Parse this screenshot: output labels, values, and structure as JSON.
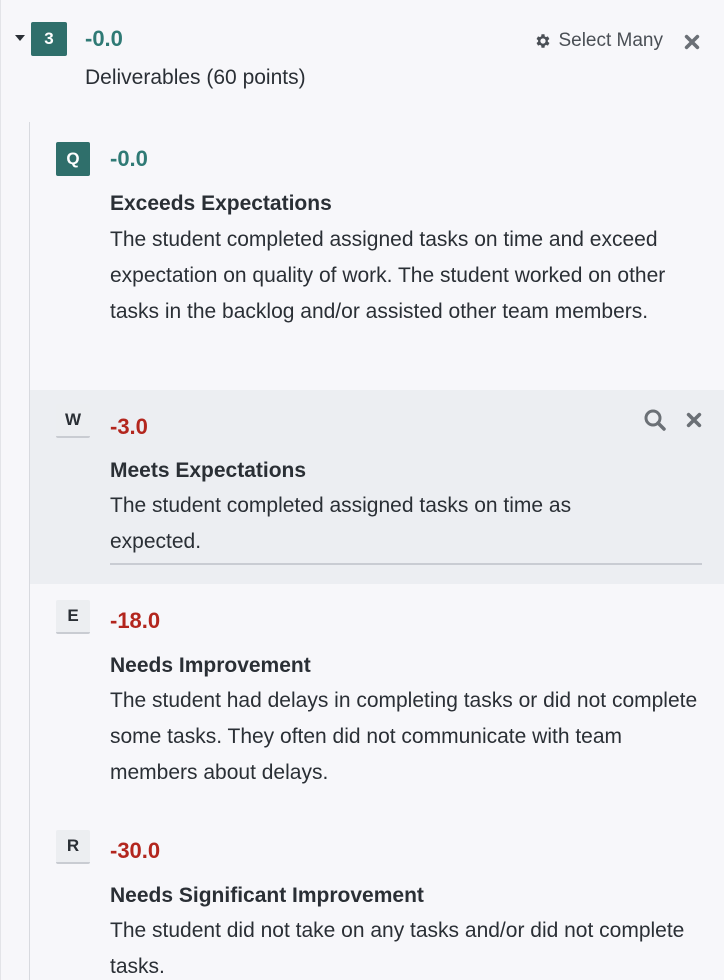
{
  "question": {
    "number": "3",
    "score": "-0.0",
    "title": "Deliverables (60 points)",
    "select_many_label": "Select Many"
  },
  "rubric_items": [
    {
      "key": "Q",
      "score": "-0.0",
      "name": "Exceeds Expectations",
      "description": "The student completed assigned tasks on time and exceed expectation on quality of work. The student worked on other tasks in the backlog and/or assisted other team members."
    },
    {
      "key": "W",
      "score": "-3.0",
      "name": "Meets Expectations",
      "description": "The student completed assigned tasks on time as expected."
    },
    {
      "key": "E",
      "score": "-18.0",
      "name": "Needs Improvement",
      "description": "The student had delays in completing tasks or did not complete some tasks. They often did not communicate with team members about delays."
    },
    {
      "key": "R",
      "score": "-30.0",
      "name": "Needs Significant Improvement",
      "description": "The student did not take on any tasks and/or did not complete tasks."
    }
  ],
  "colors": {
    "accent_teal": "#2f6f6b",
    "score_positive": "#2f7a75",
    "score_negative": "#b3261e"
  }
}
